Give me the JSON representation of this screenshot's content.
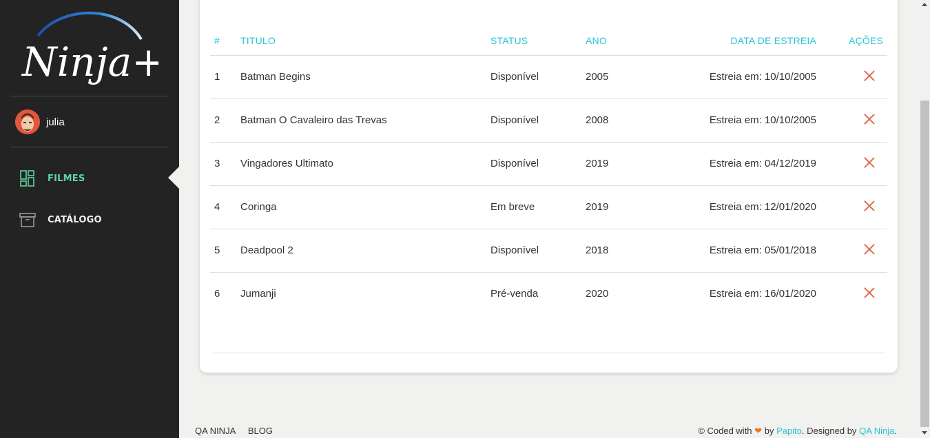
{
  "brand": {
    "logo_text": "Ninja+"
  },
  "user": {
    "name": "julia"
  },
  "nav": {
    "items": [
      {
        "label": "FILMES",
        "icon": "dashboard-icon",
        "active": true
      },
      {
        "label": "CATÁLOGO",
        "icon": "archive-box-icon",
        "active": false
      }
    ]
  },
  "table": {
    "headers": {
      "num": "#",
      "title": "TITULO",
      "status": "STATUS",
      "year": "ANO",
      "date": "DATA DE ESTREIA",
      "actions": "AÇÕES"
    },
    "rows": [
      {
        "num": "1",
        "title": "Batman Begins",
        "status": "Disponível",
        "year": "2005",
        "date": "Estreia em: 10/10/2005"
      },
      {
        "num": "2",
        "title": "Batman O Cavaleiro das Trevas",
        "status": "Disponível",
        "year": "2008",
        "date": "Estreia em: 10/10/2005"
      },
      {
        "num": "3",
        "title": "Vingadores Ultimato",
        "status": "Disponível",
        "year": "2019",
        "date": "Estreia em: 04/12/2019"
      },
      {
        "num": "4",
        "title": "Coringa",
        "status": "Em breve",
        "year": "2019",
        "date": "Estreia em: 12/01/2020"
      },
      {
        "num": "5",
        "title": "Deadpool 2",
        "status": "Disponível",
        "year": "2018",
        "date": "Estreia em: 05/01/2018"
      },
      {
        "num": "6",
        "title": "Jumanji",
        "status": "Pré-venda",
        "year": "2020",
        "date": "Estreia em: 16/01/2020"
      }
    ]
  },
  "footer": {
    "links": [
      "QA NINJA",
      "BLOG"
    ],
    "credit_prefix": "© Coded with",
    "credit_by": "by",
    "author": "Papito",
    "designed_by": ". Designed by",
    "designer": "QA Ninja",
    "credit_end": "."
  },
  "colors": {
    "accent": "#2bc4d4",
    "nav_active": "#61d3a4",
    "delete": "#e06a50",
    "sidebar": "#232323"
  }
}
